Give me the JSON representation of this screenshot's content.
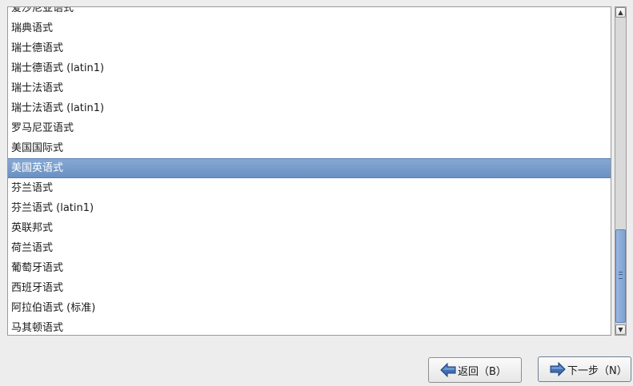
{
  "layout_list": {
    "items": [
      "爱沙尼亚语式",
      "瑞典语式",
      "瑞士德语式",
      "瑞士德语式 (latin1)",
      "瑞士法语式",
      "瑞士法语式 (latin1)",
      "罗马尼亚语式",
      "美国国际式",
      "美国英语式",
      "芬兰语式",
      "芬兰语式 (latin1)",
      "英联邦式",
      "荷兰语式",
      "葡萄牙语式",
      "西班牙语式",
      "阿拉伯语式 (标准)",
      "马其顿语式"
    ],
    "selected_item": "美国英语式",
    "scroll_fraction": 1.0
  },
  "buttons": {
    "back_label": "返回（B）",
    "next_label": "下一步（N）"
  },
  "icons": {
    "back": "arrow-left-icon",
    "next": "arrow-right-icon",
    "scroll_up": "scroll-up-arrow-icon",
    "scroll_down": "scroll-down-arrow-icon"
  },
  "colors": {
    "selection": "#7399c9",
    "arrow_icon": "#3d6fb5"
  }
}
